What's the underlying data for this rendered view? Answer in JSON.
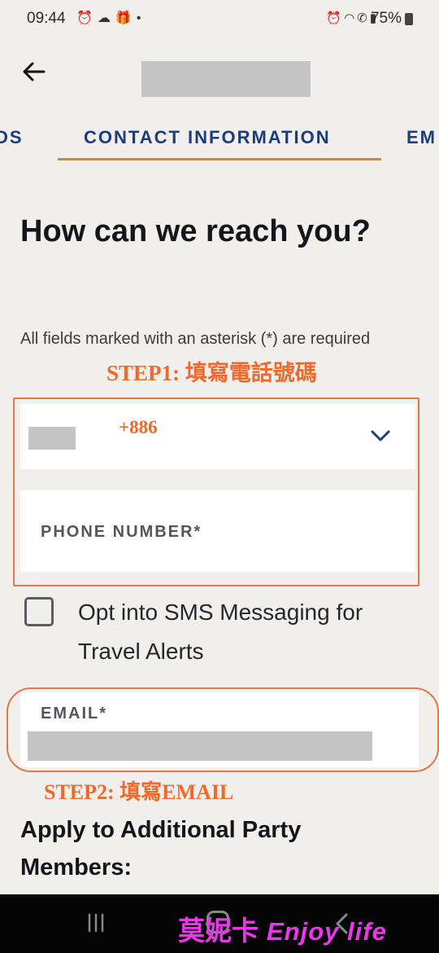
{
  "status_bar": {
    "time": "09:44",
    "left_icons": [
      "alarm-icon",
      "cloud-icon",
      "gift-icon",
      "dot-icon"
    ],
    "right_icons": [
      "alarm-icon",
      "wifi-icon",
      "wifi-call-icon",
      "signal-icon"
    ],
    "battery": "75%"
  },
  "header": {
    "back_icon": "arrow-left-icon"
  },
  "tabs": [
    {
      "label": "DS",
      "active": false
    },
    {
      "label": "CONTACT INFORMATION",
      "active": true
    },
    {
      "label": "EM",
      "active": false
    }
  ],
  "main": {
    "title": "How can we reach you?",
    "required_note": "All fields marked with an asterisk (*) are required",
    "country_select": {
      "annotation": "+886",
      "icon": "chevron-down-icon"
    },
    "phone_field": {
      "label": "PHONE NUMBER*"
    },
    "sms_opt_in": {
      "label": "Opt into SMS Messaging for Travel Alerts",
      "checked": false
    },
    "email_field": {
      "label": "EMAIL*"
    },
    "section_heading": "Apply to Additional Party Members:"
  },
  "annotations": {
    "step1": "STEP1: 填寫電話號碼",
    "step2": "STEP2: 填寫EMAIL"
  },
  "watermark": {
    "cn": "莫妮卡",
    "en": "Enjoy life"
  },
  "colors": {
    "accent_navy": "#1c3c7a",
    "tab_underline": "#b68f58",
    "annotation_orange": "#ee6a2c",
    "watermark_magenta": "#e838e8",
    "background": "#f1efec"
  }
}
